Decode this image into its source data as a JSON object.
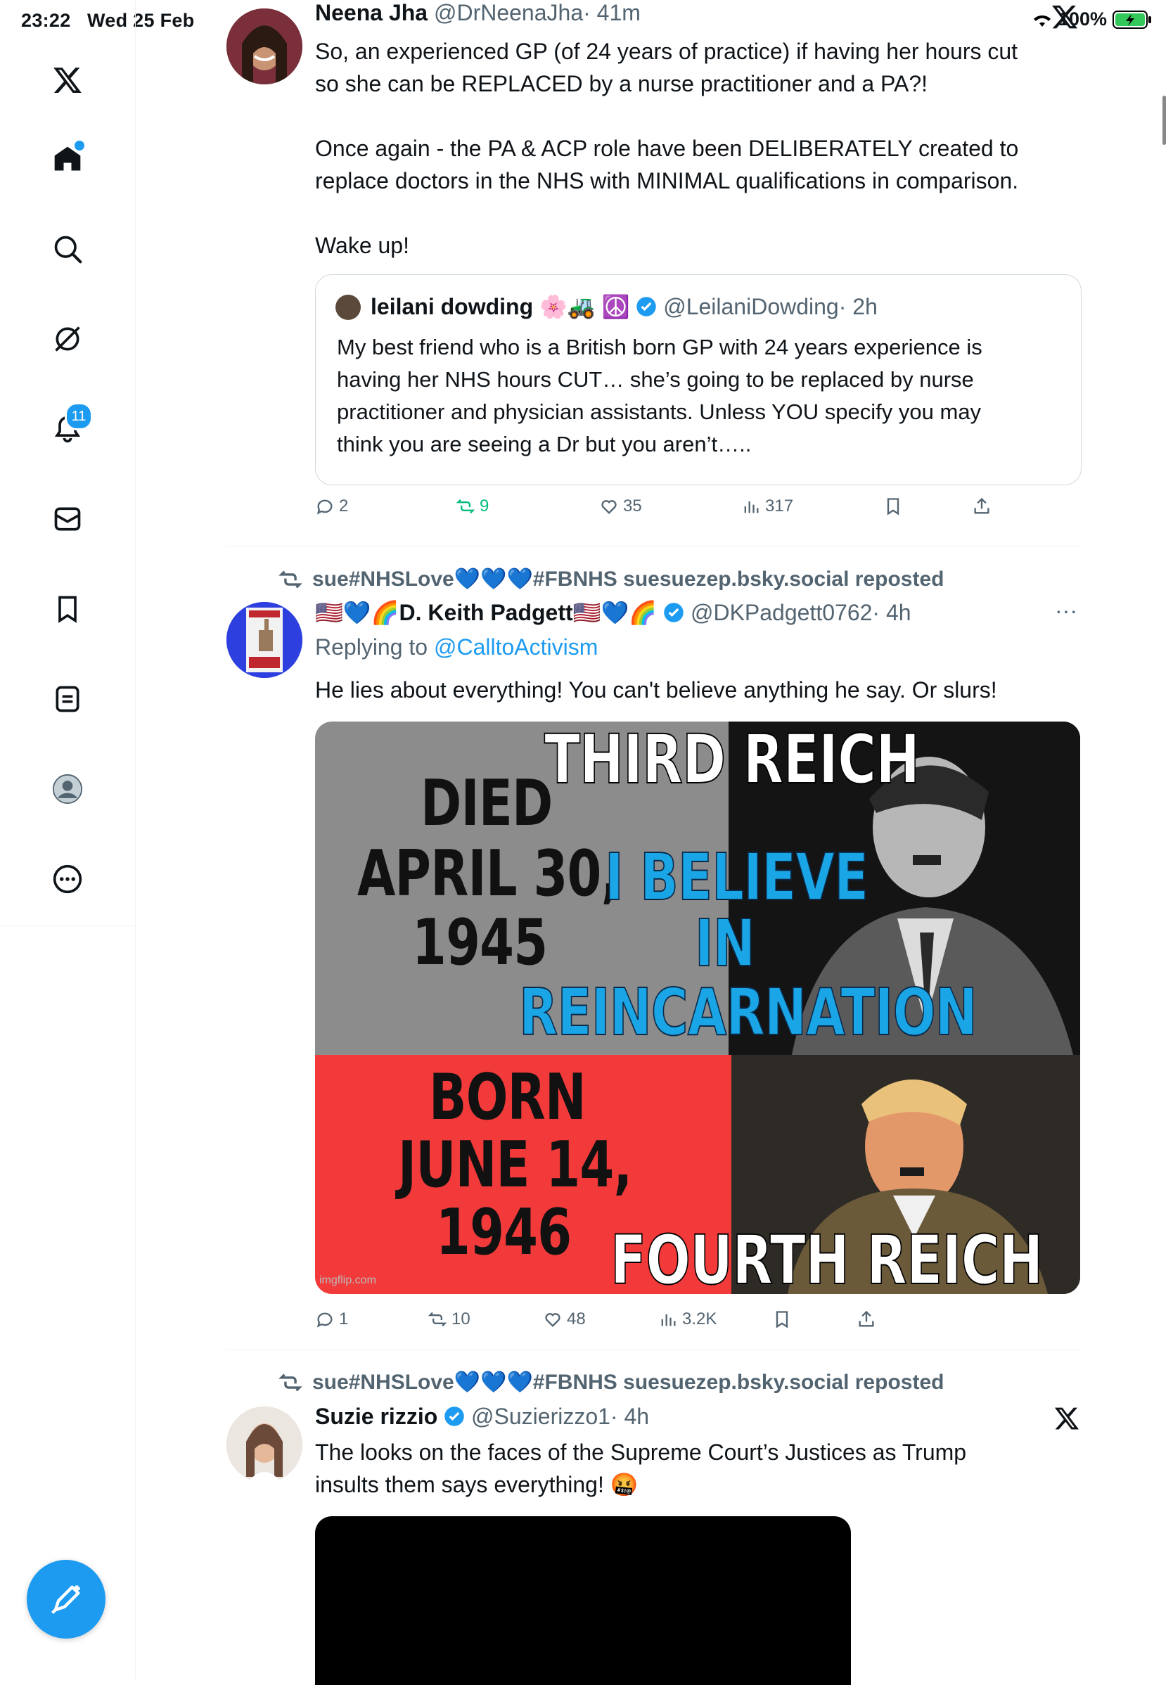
{
  "status_bar": {
    "time": "23:22",
    "date": "Wed 25 Feb",
    "battery": "100%"
  },
  "sidebar": {
    "notifications_badge": "11",
    "items": [
      "x-logo",
      "home",
      "search",
      "grok",
      "notifications",
      "messages",
      "bookmarks",
      "lists",
      "profile",
      "more"
    ]
  },
  "tweets": [
    {
      "name": "Neena Jha",
      "handle": "@DrNeenaJha",
      "time": "· 41m",
      "text_lines": [
        "So, an experienced GP (of 24 years of practice) if having her hours cut",
        "so she can be REPLACED by a nurse practitioner and a PA?!",
        "",
        "Once again - the PA & ACP role have been DELIBERATELY created to",
        "replace doctors in the NHS with MINIMAL qualifications in comparison.",
        "",
        "Wake up!"
      ],
      "quote": {
        "name": "leilani dowding",
        "name_emojis": "🌸🚜 ☮️",
        "handle": "@LeilaniDowding",
        "time": "· 2h",
        "text_lines": [
          "My best friend who is a British born GP with 24 years experience is",
          "having her NHS hours  CUT… she’s going to be replaced by nurse",
          "practitioner and physician assistants.  Unless YOU specify you may",
          "think you are seeing a Dr but you aren’t….."
        ]
      },
      "replies": "2",
      "reposts": "9",
      "likes": "35",
      "views": "317"
    },
    {
      "repost_by": "sue#NHSLove💙💙💙#FBNHS suesuezep.bsky.social reposted",
      "name_prefix": "🇺🇸💙🌈",
      "name": "D. Keith Padgett",
      "name_suffix": "🇺🇸💙🌈",
      "handle": "@DKPadgett0762",
      "time": "· 4h",
      "replying_label": "Replying to",
      "replying_to": "@CalltoActivism",
      "text": "He lies about everything! You can't believe anything he say. Or slurs!",
      "meme": {
        "top_left_1": "DIED",
        "top_left_2": "APRIL 30,",
        "top_left_3": "1945",
        "top_title": "THIRD REICH",
        "blue_1": "I BELIEVE",
        "blue_2": "IN",
        "blue_3": "REINCARNATION",
        "bottom_1": "BORN",
        "bottom_2": "JUNE 14,",
        "bottom_3": "1946",
        "bottom_title": "FOURTH REICH",
        "watermark": "imgflip.com"
      },
      "replies": "1",
      "reposts": "10",
      "likes": "48",
      "views": "3.2K"
    },
    {
      "repost_by": "sue#NHSLove💙💙💙#FBNHS suesuezep.bsky.social reposted",
      "name": "Suzie rizzio",
      "handle": "@Suzierizzo1",
      "time": "· 4h",
      "text_lines": [
        "The looks on the faces of the Supreme Court’s Justices as Trump",
        "insults them says everything! 🤬"
      ]
    }
  ],
  "colors": {
    "accent": "#1d9bf0",
    "text": "#0f1419",
    "muted": "#536471",
    "repost_green": "#00ba7c"
  }
}
